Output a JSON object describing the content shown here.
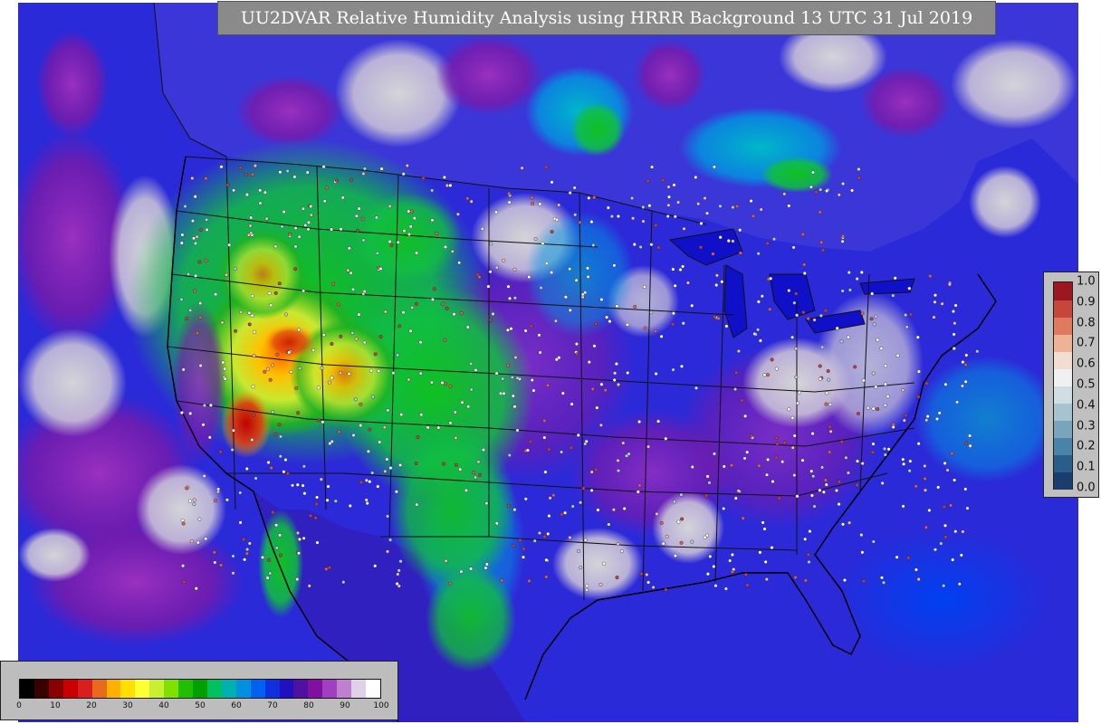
{
  "title": "UU2DVAR Relative Humidity Analysis using HRRR Background 13 UTC 31 Jul 2019",
  "colors": {
    "ocean": "#2a2ad8",
    "land_missing": "#c8c8c8",
    "deep_sea": "#1010c8",
    "state_lines": "#111111",
    "title_bg": "#8a8a8a"
  },
  "diverging_legend": {
    "ticks": [
      "0.0",
      "0.1",
      "0.2",
      "0.3",
      "0.4",
      "0.5",
      "0.6",
      "0.7",
      "0.8",
      "0.9",
      "1.0"
    ],
    "colors": [
      "#1b3c6e",
      "#2a5d8a",
      "#4a82a8",
      "#7aa4bc",
      "#a7c3cf",
      "#d0dde2",
      "#eef0f2",
      "#f2ddd2",
      "#eeb296",
      "#de7b5f",
      "#c6463c",
      "#9c1820"
    ]
  },
  "rh_colorbar": {
    "ticks": [
      "0",
      "10",
      "20",
      "30",
      "40",
      "50",
      "60",
      "70",
      "80",
      "90",
      "100"
    ],
    "colors": [
      "#000000",
      "#3a0000",
      "#8a0000",
      "#c80000",
      "#d81e1e",
      "#e86a1a",
      "#ffb000",
      "#ffe000",
      "#ffff33",
      "#c8f032",
      "#80e000",
      "#20c000",
      "#00a000",
      "#00c060",
      "#00b0b0",
      "#0090e0",
      "#0060f0",
      "#1030e0",
      "#2010c0",
      "#5010a0",
      "#8010a0",
      "#a040c0",
      "#c080d0",
      "#e0d0e8",
      "#ffffff"
    ]
  }
}
